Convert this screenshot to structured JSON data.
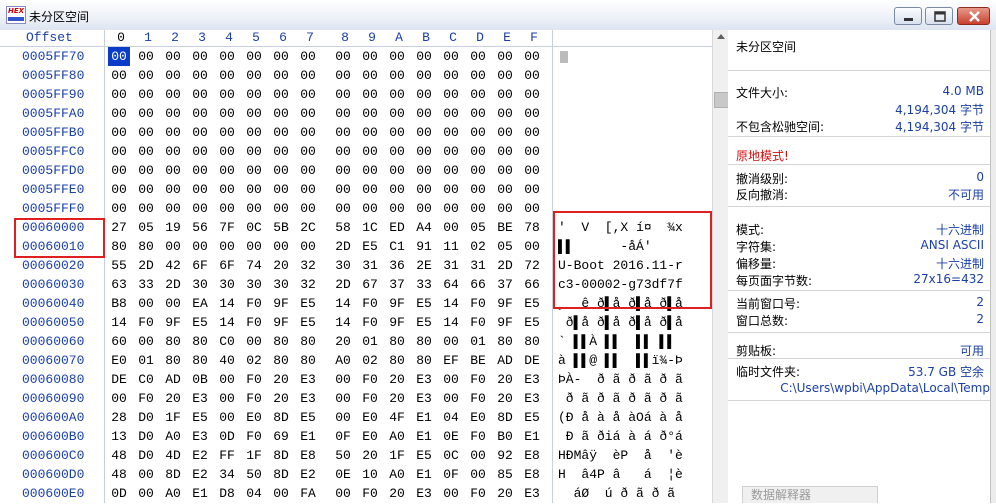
{
  "window": {
    "title": "未分区空间",
    "icon_text": "HEX",
    "buttons": [
      "minimize",
      "maximize",
      "close"
    ]
  },
  "hex": {
    "offset_header": "Offset",
    "columns": [
      "0",
      "1",
      "2",
      "3",
      "4",
      "5",
      "6",
      "7",
      "8",
      "9",
      "A",
      "B",
      "C",
      "D",
      "E",
      "F"
    ],
    "rows": [
      {
        "offset": "0005FF70",
        "bytes": [
          "00",
          "00",
          "00",
          "00",
          "00",
          "00",
          "00",
          "00",
          "00",
          "00",
          "00",
          "00",
          "00",
          "00",
          "00",
          "00"
        ],
        "text": ""
      },
      {
        "offset": "0005FF80",
        "bytes": [
          "00",
          "00",
          "00",
          "00",
          "00",
          "00",
          "00",
          "00",
          "00",
          "00",
          "00",
          "00",
          "00",
          "00",
          "00",
          "00"
        ],
        "text": ""
      },
      {
        "offset": "0005FF90",
        "bytes": [
          "00",
          "00",
          "00",
          "00",
          "00",
          "00",
          "00",
          "00",
          "00",
          "00",
          "00",
          "00",
          "00",
          "00",
          "00",
          "00"
        ],
        "text": ""
      },
      {
        "offset": "0005FFA0",
        "bytes": [
          "00",
          "00",
          "00",
          "00",
          "00",
          "00",
          "00",
          "00",
          "00",
          "00",
          "00",
          "00",
          "00",
          "00",
          "00",
          "00"
        ],
        "text": ""
      },
      {
        "offset": "0005FFB0",
        "bytes": [
          "00",
          "00",
          "00",
          "00",
          "00",
          "00",
          "00",
          "00",
          "00",
          "00",
          "00",
          "00",
          "00",
          "00",
          "00",
          "00"
        ],
        "text": ""
      },
      {
        "offset": "0005FFC0",
        "bytes": [
          "00",
          "00",
          "00",
          "00",
          "00",
          "00",
          "00",
          "00",
          "00",
          "00",
          "00",
          "00",
          "00",
          "00",
          "00",
          "00"
        ],
        "text": ""
      },
      {
        "offset": "0005FFD0",
        "bytes": [
          "00",
          "00",
          "00",
          "00",
          "00",
          "00",
          "00",
          "00",
          "00",
          "00",
          "00",
          "00",
          "00",
          "00",
          "00",
          "00"
        ],
        "text": ""
      },
      {
        "offset": "0005FFE0",
        "bytes": [
          "00",
          "00",
          "00",
          "00",
          "00",
          "00",
          "00",
          "00",
          "00",
          "00",
          "00",
          "00",
          "00",
          "00",
          "00",
          "00"
        ],
        "text": ""
      },
      {
        "offset": "0005FFF0",
        "bytes": [
          "00",
          "00",
          "00",
          "00",
          "00",
          "00",
          "00",
          "00",
          "00",
          "00",
          "00",
          "00",
          "00",
          "00",
          "00",
          "00"
        ],
        "text": ""
      },
      {
        "offset": "00060000",
        "bytes": [
          "27",
          "05",
          "19",
          "56",
          "7F",
          "0C",
          "5B",
          "2C",
          "58",
          "1C",
          "ED",
          "A4",
          "00",
          "05",
          "BE",
          "78"
        ],
        "text": "'  V  [,X í¤  ¾x"
      },
      {
        "offset": "00060010",
        "bytes": [
          "80",
          "80",
          "00",
          "00",
          "00",
          "00",
          "00",
          "00",
          "2D",
          "E5",
          "C1",
          "91",
          "11",
          "02",
          "05",
          "00"
        ],
        "text": "▌▌      -åÁ'"
      },
      {
        "offset": "00060020",
        "bytes": [
          "55",
          "2D",
          "42",
          "6F",
          "6F",
          "74",
          "20",
          "32",
          "30",
          "31",
          "36",
          "2E",
          "31",
          "31",
          "2D",
          "72"
        ],
        "text": "U-Boot 2016.11-r"
      },
      {
        "offset": "00060030",
        "bytes": [
          "63",
          "33",
          "2D",
          "30",
          "30",
          "30",
          "30",
          "32",
          "2D",
          "67",
          "37",
          "33",
          "64",
          "66",
          "37",
          "66"
        ],
        "text": "c3-00002-g73df7f"
      },
      {
        "offset": "00060040",
        "bytes": [
          "B8",
          "00",
          "00",
          "EA",
          "14",
          "F0",
          "9F",
          "E5",
          "14",
          "F0",
          "9F",
          "E5",
          "14",
          "F0",
          "9F",
          "E5"
        ],
        "text": "¸  ê ð▌å ð▌å ð▌å"
      },
      {
        "offset": "00060050",
        "bytes": [
          "14",
          "F0",
          "9F",
          "E5",
          "14",
          "F0",
          "9F",
          "E5",
          "14",
          "F0",
          "9F",
          "E5",
          "14",
          "F0",
          "9F",
          "E5"
        ],
        "text": " ð▌å ð▌å ð▌å ð▌å"
      },
      {
        "offset": "00060060",
        "bytes": [
          "60",
          "00",
          "80",
          "80",
          "C0",
          "00",
          "80",
          "80",
          "20",
          "01",
          "80",
          "80",
          "00",
          "01",
          "80",
          "80"
        ],
        "text": "` ▌▌À ▌▌  ▌▌ ▌▌"
      },
      {
        "offset": "00060070",
        "bytes": [
          "E0",
          "01",
          "80",
          "80",
          "40",
          "02",
          "80",
          "80",
          "A0",
          "02",
          "80",
          "80",
          "EF",
          "BE",
          "AD",
          "DE"
        ],
        "text": "à ▌▌@ ▌▌  ▌▌ï¾-Þ"
      },
      {
        "offset": "00060080",
        "bytes": [
          "DE",
          "C0",
          "AD",
          "0B",
          "00",
          "F0",
          "20",
          "E3",
          "00",
          "F0",
          "20",
          "E3",
          "00",
          "F0",
          "20",
          "E3"
        ],
        "text": "ÞÀ-  ð ã ð ã ð ã"
      },
      {
        "offset": "00060090",
        "bytes": [
          "00",
          "F0",
          "20",
          "E3",
          "00",
          "F0",
          "20",
          "E3",
          "00",
          "F0",
          "20",
          "E3",
          "00",
          "F0",
          "20",
          "E3"
        ],
        "text": " ð ã ð ã ð ã ð ã"
      },
      {
        "offset": "000600A0",
        "bytes": [
          "28",
          "D0",
          "1F",
          "E5",
          "00",
          "E0",
          "8D",
          "E5",
          "00",
          "E0",
          "4F",
          "E1",
          "04",
          "E0",
          "8D",
          "E5"
        ],
        "text": "(Ð å à å àOá à å"
      },
      {
        "offset": "000600B0",
        "bytes": [
          "13",
          "D0",
          "A0",
          "E3",
          "0D",
          "F0",
          "69",
          "E1",
          "0F",
          "E0",
          "A0",
          "E1",
          "0E",
          "F0",
          "B0",
          "E1"
        ],
        "text": " Ð ã ðiá à á ð°á"
      },
      {
        "offset": "000600C0",
        "bytes": [
          "48",
          "D0",
          "4D",
          "E2",
          "FF",
          "1F",
          "8D",
          "E8",
          "50",
          "20",
          "1F",
          "E5",
          "0C",
          "00",
          "92",
          "E8"
        ],
        "text": "HÐMâÿ  èP  å  'è"
      },
      {
        "offset": "000600D0",
        "bytes": [
          "48",
          "00",
          "8D",
          "E2",
          "34",
          "50",
          "8D",
          "E2",
          "0E",
          "10",
          "A0",
          "E1",
          "0F",
          "00",
          "85",
          "E8"
        ],
        "text": "H  â4P â   á  ¦è"
      },
      {
        "offset": "000600E0",
        "bytes": [
          "0D",
          "00",
          "A0",
          "E1",
          "D8",
          "04",
          "00",
          "FA",
          "00",
          "F0",
          "20",
          "E3",
          "00",
          "F0",
          "20",
          "E3"
        ],
        "text": "  áØ  ú ð ã ð ã"
      }
    ]
  },
  "panel": {
    "title": "未分区空间",
    "file_size_label": "文件大小:",
    "file_size_value": "4.0 MB",
    "file_size_bytes": "4,194,304 字节",
    "no_slack_label": "不包含松驰空间:",
    "no_slack_value": "4,194,304 字节",
    "mode": "原地模式!",
    "undo_level_label": "撤消级别:",
    "undo_level_value": "0",
    "reverse_undo_label": "反向撤消:",
    "reverse_undo_value": "不可用",
    "mode_label": "模式:",
    "mode_value": "十六进制",
    "charset_label": "字符集:",
    "charset_value": "ANSI ASCII",
    "offset_label": "偏移量:",
    "offset_value": "十六进制",
    "bytes_per_page_label": "每页面字节数:",
    "bytes_per_page_value": "27x16=432",
    "current_window_label": "当前窗口号:",
    "current_window_value": "2",
    "window_total_label": "窗口总数:",
    "window_total_value": "2",
    "clipboard_label": "剪贴板:",
    "clipboard_value": "可用",
    "temp_folder_label": "临时文件夹:",
    "temp_folder_size": "53.7 GB 空余",
    "temp_folder_path": "C:\\Users\\wpbi\\AppData\\Local\\Temp",
    "interpreter_tab": "数据解释器"
  },
  "colors": {
    "offset_blue": "#1a3fa8",
    "highlight_red": "#e02020",
    "caret_blue": "#0a3cc8"
  }
}
